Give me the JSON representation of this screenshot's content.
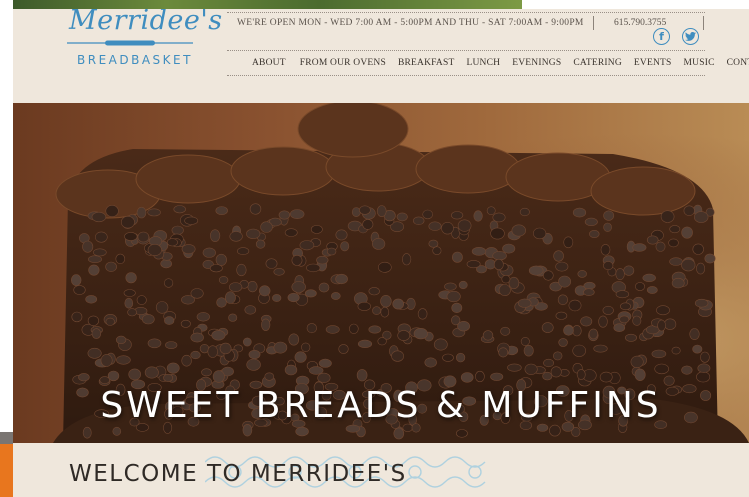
{
  "brand": {
    "script_name": "Merridee's",
    "subtitle": "BREADBASKET",
    "blue": "#3f8dbf"
  },
  "header": {
    "hours": "WE'RE OPEN MON - WED 7:00 AM - 5:00PM AND THU - SAT 7:00AM - 9:00PM",
    "phone": "615.790.3755",
    "social": [
      {
        "name": "facebook-icon",
        "glyph": "f"
      },
      {
        "name": "twitter-icon",
        "glyph": "🐦"
      }
    ]
  },
  "nav": {
    "items": [
      "ABOUT",
      "FROM OUR OVENS",
      "BREAKFAST",
      "LUNCH",
      "EVENINGS",
      "CATERING",
      "EVENTS",
      "MUSIC",
      "CONTACT"
    ]
  },
  "hero": {
    "title": "SWEET BREADS & MUFFINS",
    "image": "chocolate-chip-cake"
  },
  "welcome": {
    "heading": "WELCOME TO MERRIDEE'S"
  },
  "colors": {
    "page_bg": "#efe7dc",
    "text_dark": "#2f2a26",
    "accent_orange": "#e8761e"
  }
}
